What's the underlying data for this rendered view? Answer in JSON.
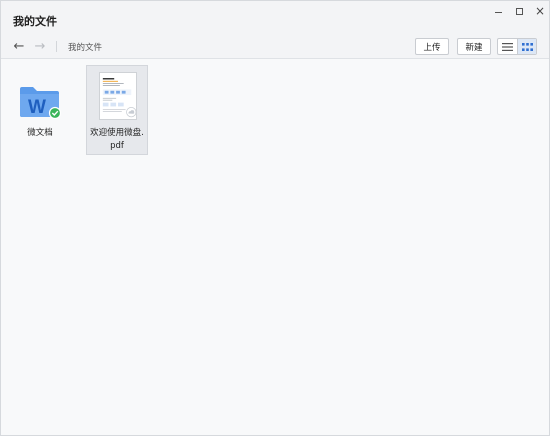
{
  "window": {
    "title": "我的文件",
    "controls": {
      "minimize": "minimize",
      "maximize": "maximize",
      "close": "×"
    }
  },
  "toolbar": {
    "breadcrumb": "我的文件",
    "upload_label": "上传",
    "new_label": "新建",
    "back_icon": "←",
    "forward_icon": "→"
  },
  "files": [
    {
      "name": "微文档",
      "type": "folder",
      "icon": "weiwendang-folder-icon",
      "status": "synced"
    },
    {
      "name": "欢迎使用微盘.pdf",
      "name_line1": "欢迎使用微盘.",
      "name_line2": "pdf",
      "type": "pdf",
      "selected": true,
      "status": "cloud"
    }
  ],
  "colors": {
    "folder_blue": "#5b9bea",
    "folder_letter": "#1f5fbf",
    "sync_green": "#3bb55b",
    "selected_bg": "#e6e8ec"
  }
}
